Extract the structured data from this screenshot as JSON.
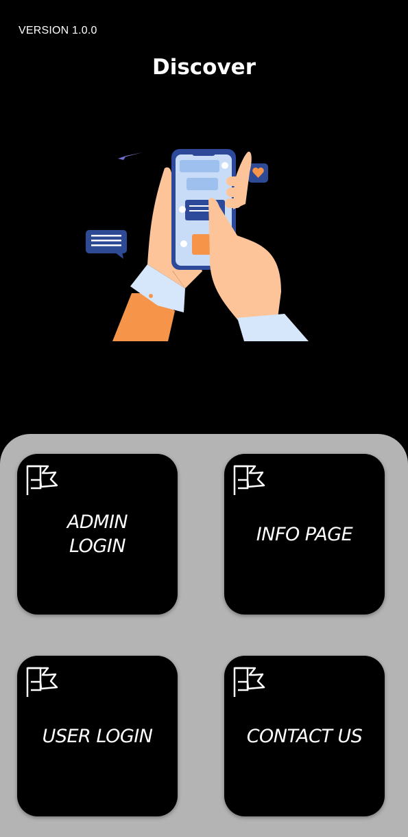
{
  "header": {
    "version": "VERSION 1.0.0",
    "title": "Discover"
  },
  "illustration": {
    "name": "hands-holding-phone-chat-illustration"
  },
  "tiles": [
    {
      "label": "ADMIN\nLOGIN",
      "icon": "flag-icon"
    },
    {
      "label": "INFO PAGE",
      "icon": "flag-icon"
    },
    {
      "label": "USER LOGIN",
      "icon": "flag-icon"
    },
    {
      "label": "CONTACT US",
      "icon": "flag-icon"
    }
  ],
  "colors": {
    "background": "#000000",
    "panel": "#b4b4b4",
    "tile": "#000000",
    "text": "#ffffff",
    "skin": "#fdc49a",
    "sleeve": "#d6e6fb",
    "accent_orange": "#f6944a",
    "phone_blue": "#2d4a9a"
  }
}
